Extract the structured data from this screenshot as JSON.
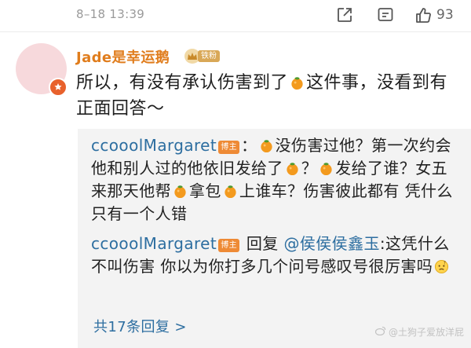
{
  "post": {
    "timestamp": "8–18 13:39",
    "like_count": "93",
    "actions": [
      "share-icon",
      "comment-icon",
      "like-icon"
    ]
  },
  "comment": {
    "username": "Jade是幸运鹅",
    "fan_badge": "铁粉",
    "text_parts": [
      "所以，有没有承认伤害到了",
      "这件事，没看到有正面回答～"
    ]
  },
  "replies": [
    {
      "author": "ccooolMargaret",
      "badge": "博主",
      "text_parts": [
        "：",
        "没伤害过他？第一次约会他和别人过的他依旧发给了",
        "？",
        "发给了谁？女五来那天他帮",
        "拿包",
        "上谁车？伤害彼此都有 凭什么只有一个人错"
      ]
    },
    {
      "author": "ccooolMargaret",
      "badge": "博主",
      "reply_word": "回复",
      "mention": "@侯侯侯鑫玉",
      "text": ":这凭什么不叫伤害 你以为你打多几个问号感叹号很厉害吗"
    }
  ],
  "more_replies": "共17条回复 >",
  "watermark": "@土狗子爱放洋屁",
  "colors": {
    "username": "#e07d1d",
    "link": "#2d6ea0",
    "reply_bg": "#f3f3f3",
    "blogger_tag": "#ee8a35",
    "avatar": "#f7d9dc"
  },
  "icons": {
    "orange": "tangerine-emoji",
    "confused": "confused-face-emoji"
  }
}
